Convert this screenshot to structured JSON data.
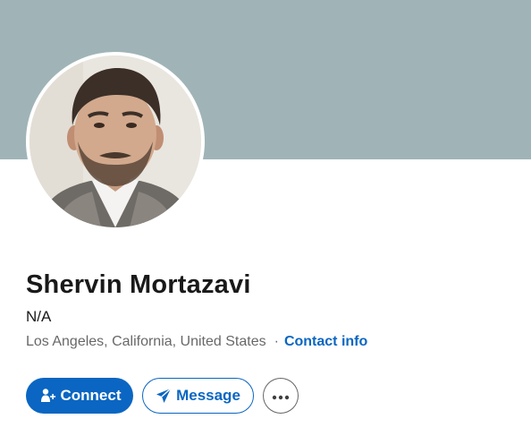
{
  "profile": {
    "name": "Shervin Mortazavi",
    "headline": "N/A",
    "location": "Los Angeles, California, United States",
    "separator": "·",
    "contact_info_label": "Contact info"
  },
  "actions": {
    "connect_label": "Connect",
    "message_label": "Message",
    "more_icon": "more-horizontal-icon"
  },
  "colors": {
    "cover": "#a0b4b7",
    "accent": "#0a66c2"
  }
}
